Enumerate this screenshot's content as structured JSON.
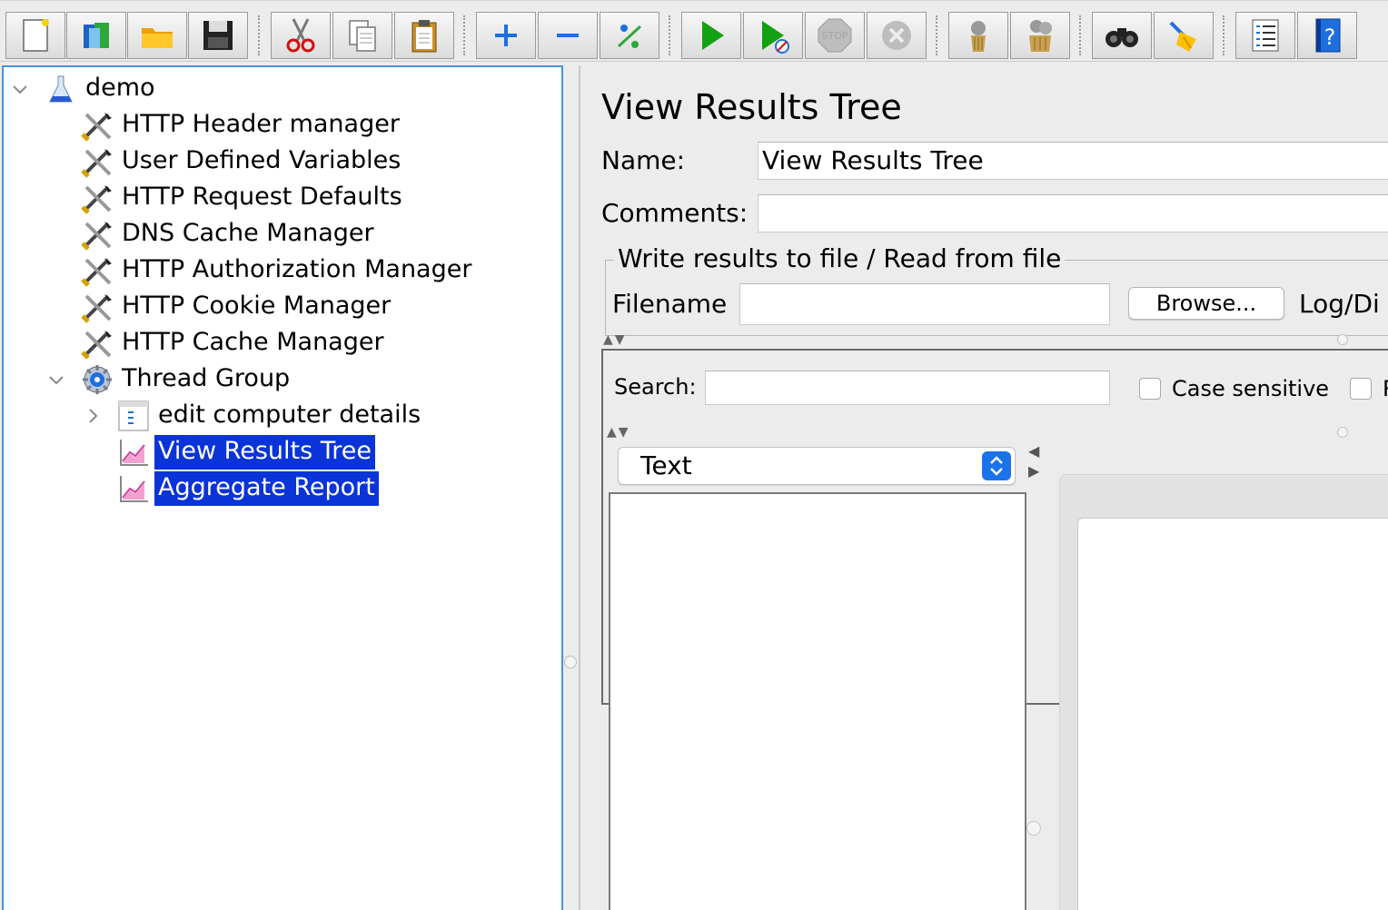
{
  "toolbar": {
    "icons": [
      "new-icon",
      "templates-icon",
      "open-icon",
      "save-icon",
      "cut-icon",
      "copy-icon",
      "paste-icon",
      "expand-icon",
      "collapse-icon",
      "toggle-icon",
      "start-icon",
      "start-no-pauses-icon",
      "stop-icon",
      "shutdown-icon",
      "clear-icon",
      "clear-all-icon",
      "search-icon",
      "reset-search-icon",
      "function-helper-icon",
      "help-icon"
    ],
    "stop_label": "STOP"
  },
  "tree": {
    "items": [
      {
        "label": "demo",
        "icon": "test-plan-icon"
      },
      {
        "label": "HTTP Header manager",
        "icon": "config-element-icon"
      },
      {
        "label": "User Defined Variables",
        "icon": "config-element-icon"
      },
      {
        "label": "HTTP Request Defaults",
        "icon": "config-element-icon"
      },
      {
        "label": "DNS Cache Manager",
        "icon": "config-element-icon"
      },
      {
        "label": "HTTP Authorization Manager",
        "icon": "config-element-icon"
      },
      {
        "label": "HTTP Cookie Manager",
        "icon": "config-element-icon"
      },
      {
        "label": "HTTP Cache Manager",
        "icon": "config-element-icon"
      },
      {
        "label": "Thread Group",
        "icon": "thread-group-icon"
      },
      {
        "label": "edit computer details",
        "icon": "transaction-controller-icon"
      },
      {
        "label": "View Results Tree",
        "icon": "listener-icon"
      },
      {
        "label": "Aggregate Report",
        "icon": "listener-icon"
      }
    ]
  },
  "panel": {
    "title": "View Results Tree",
    "name_label": "Name:",
    "name_value": "View Results Tree",
    "comments_label": "Comments:",
    "comments_value": "",
    "file_group_title": "Write results to file / Read from file",
    "filename_label": "Filename",
    "filename_value": "",
    "browse_label": "Browse...",
    "log_label": "Log/Di",
    "search_label": "Search:",
    "search_value": "",
    "case_sensitive_label": "Case sensitive",
    "regex_label": "R",
    "renderer_selected": "Text"
  },
  "colors": {
    "selection": "#0a34d8",
    "focus_border": "#4a90e2",
    "select_accent": "#1a73e8"
  }
}
